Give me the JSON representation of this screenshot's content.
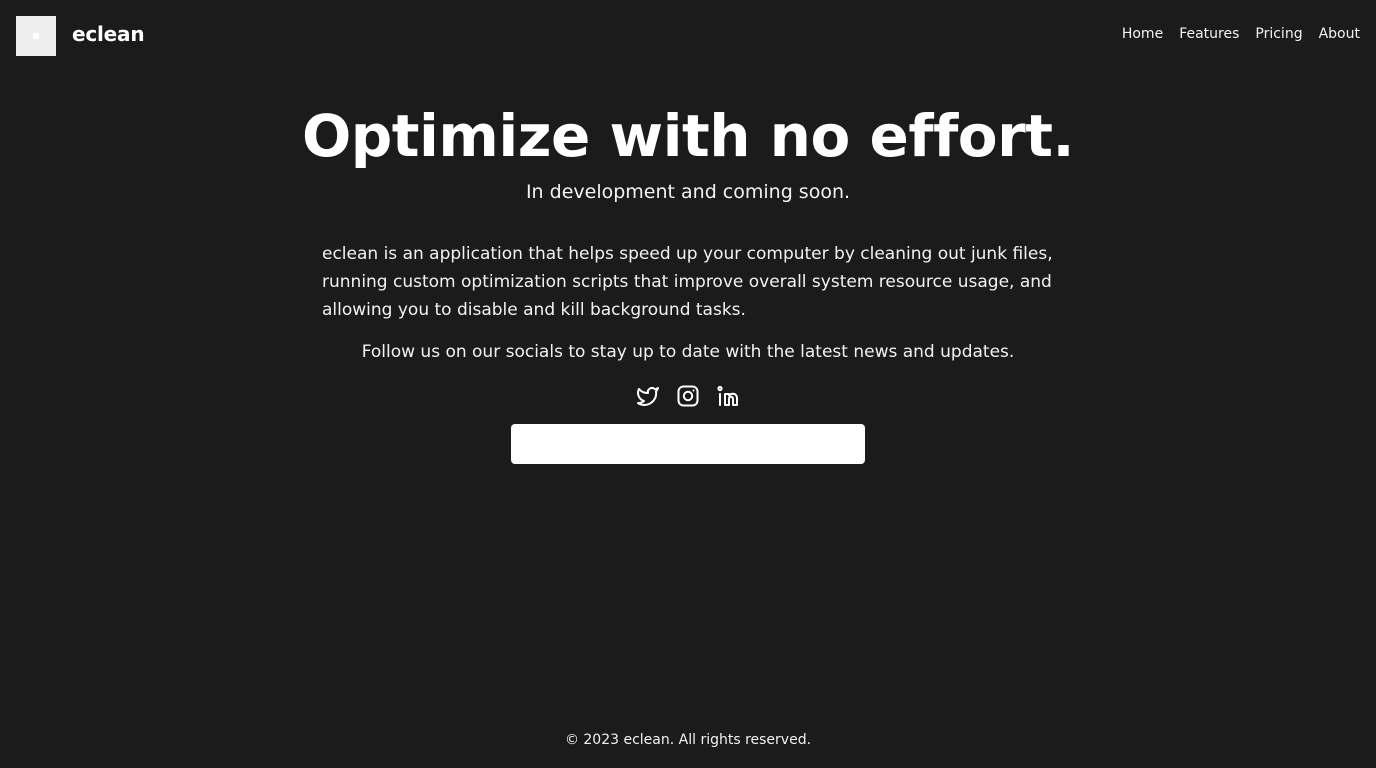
{
  "header": {
    "brand": "eclean",
    "nav": [
      {
        "label": "Home"
      },
      {
        "label": "Features"
      },
      {
        "label": "Pricing"
      },
      {
        "label": "About"
      }
    ]
  },
  "hero": {
    "title": "Optimize with no effort.",
    "subtitle": "In development and coming soon.",
    "description": "eclean is an application that helps speed up your computer by cleaning out junk files, running custom optimization scripts that improve overall system resource usage, and allowing you to disable and kill background tasks.",
    "follow_text": "Follow us on our socials to stay up to date with the latest news and updates."
  },
  "socials": [
    {
      "icon": "twitter-icon"
    },
    {
      "icon": "instagram-icon"
    },
    {
      "icon": "linkedin-icon"
    }
  ],
  "signup": {
    "value": "",
    "placeholder": ""
  },
  "footer": {
    "copyright": "© 2023 eclean. All rights reserved."
  },
  "colors": {
    "background": "#1b1b1b",
    "text": "#f2f2f2",
    "heading": "#ffffff",
    "logo_box": "#eeeeee",
    "input_bg": "#ffffff"
  }
}
